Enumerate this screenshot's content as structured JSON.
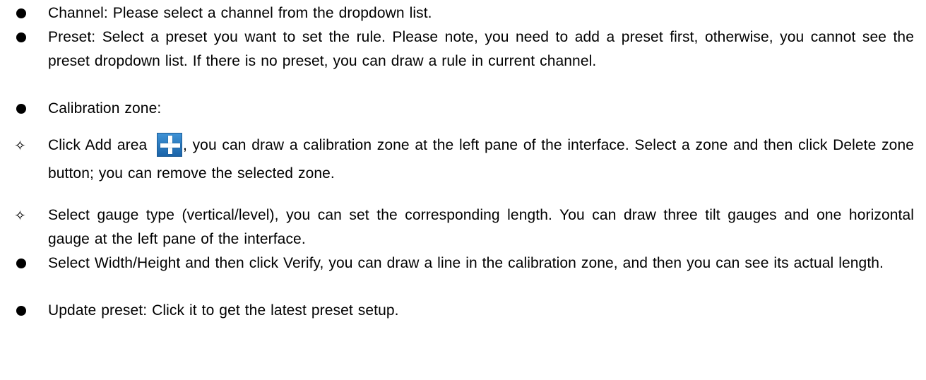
{
  "bullets": {
    "channel": "Channel: Please select a channel from the dropdown list.",
    "preset": "Preset: Select a preset you want to set the rule. Please note, you need to add a preset first, otherwise, you cannot see the preset dropdown list. If there is no preset, you can draw a rule in current channel.",
    "calibration_zone": "Calibration zone:",
    "add_area_before": "Click Add area ",
    "add_area_after": ", you can draw a calibration zone at the left pane of the interface. Select a zone and then click Delete zone button; you can remove the selected zone.",
    "gauge_type": "Select gauge type (vertical/level), you can set the corresponding length. You can draw three tilt gauges and one horizontal gauge at the left pane of the interface.",
    "width_height": "Select Width/Height and then click Verify, you can draw a line in the calibration zone, and then you can see its actual length.",
    "update_preset": "Update preset: Click it to get the latest preset setup."
  },
  "symbols": {
    "sub_bullet": "✧"
  },
  "icons": {
    "add_area": "plus-icon"
  }
}
